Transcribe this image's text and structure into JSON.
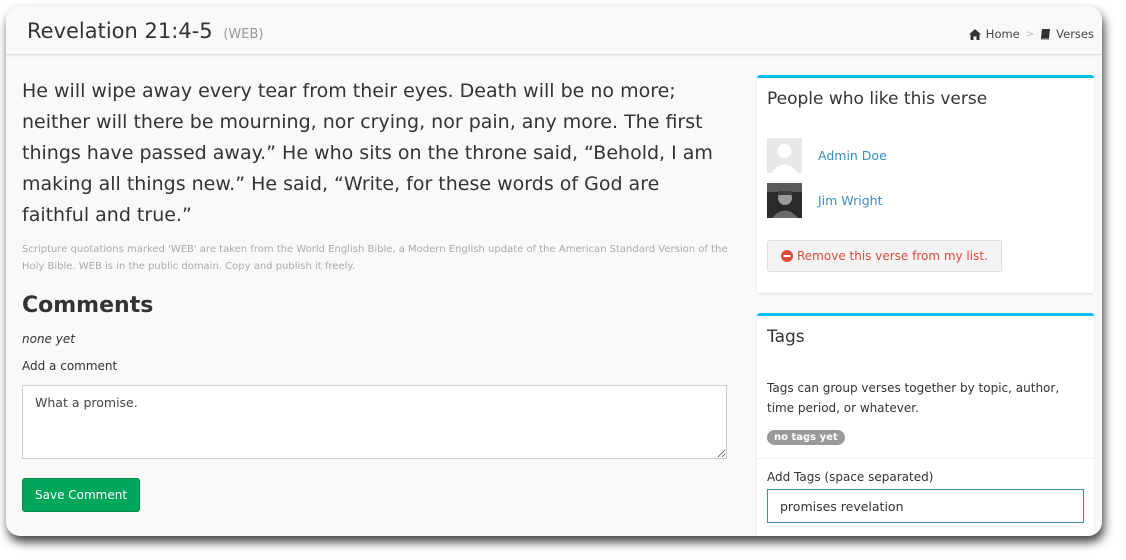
{
  "header": {
    "title": "Revelation 21:4-5",
    "subtitle": "(WEB)",
    "breadcrumb": {
      "home": "Home",
      "separator": ">",
      "verses": "Verses"
    }
  },
  "verse": {
    "text": "He will wipe away every tear from their eyes. Death will be no more; neither will there be mourning, nor crying, nor pain, any more. The first things have passed away.” He who sits on the throne said, “Behold, I am making all things new.” He said, “Write, for these words of God are faithful and true.”",
    "copyright": "Scripture quotations marked 'WEB' are taken from the World English Bible, a Modern English update of the American Standard Version of the Holy Bible. WEB is in the public domain. Copy and publish it freely."
  },
  "comments": {
    "heading": "Comments",
    "empty_text": "none yet",
    "add_label": "Add a comment",
    "input_value": "What a promise.",
    "save_label": "Save Comment"
  },
  "likes": {
    "title": "People who like this verse",
    "people": [
      {
        "name": "Admin Doe",
        "avatar": "default-avatar"
      },
      {
        "name": "Jim Wright",
        "avatar": "photo-avatar"
      }
    ],
    "remove_label": "Remove this verse from my list."
  },
  "tags": {
    "title": "Tags",
    "description": "Tags can group verses together by topic, author, time period, or whatever.",
    "empty_badge": "no tags yet",
    "add_label": "Add Tags (space separated)",
    "input_value": "promises revelation"
  },
  "colors": {
    "accent": "#00c0ef",
    "link": "#3c8dbc",
    "success": "#00a65a",
    "danger": "#dd4b39"
  },
  "icons": {
    "home": "home-icon",
    "verses": "book-icon",
    "remove": "minus-circle-icon"
  }
}
